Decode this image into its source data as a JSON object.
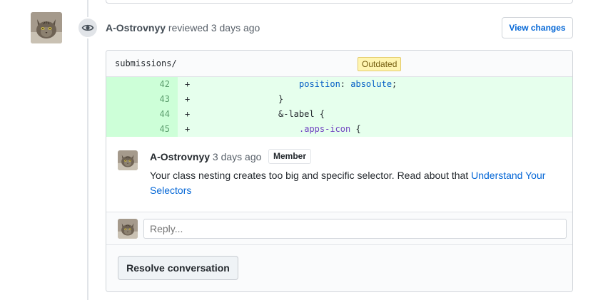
{
  "review": {
    "author": "A-Ostrovnyy",
    "action": "reviewed",
    "time": "3 days ago",
    "view_changes_label": "View changes"
  },
  "file": {
    "path": "submissions/",
    "badge": "Outdated"
  },
  "diff": {
    "lines": [
      {
        "num": "42",
        "marker": "+",
        "text": "position",
        "rest": ": ",
        "value": "absolute",
        "end": ";"
      },
      {
        "num": "43",
        "marker": "+",
        "text": "}"
      },
      {
        "num": "44",
        "marker": "+",
        "text": "&-label {"
      },
      {
        "num": "45",
        "marker": "+",
        "text": ".apps-icon",
        "rest": " {"
      }
    ]
  },
  "comment": {
    "author": "A-Ostrovnyy",
    "time": "3 days ago",
    "role": "Member",
    "body": "Your class nesting creates too big and specific selector. Read about that ",
    "link_text": "Understand Your Selectors"
  },
  "reply": {
    "placeholder": "Reply..."
  },
  "resolve_label": "Resolve conversation",
  "icons": {
    "review_status": "eye-icon",
    "avatar": "cat-avatar"
  },
  "colors": {
    "link": "#0366d6",
    "addition_bg": "#e6ffed",
    "addition_num_bg": "#cdffd8",
    "outdated_bg": "#fff5b1"
  }
}
